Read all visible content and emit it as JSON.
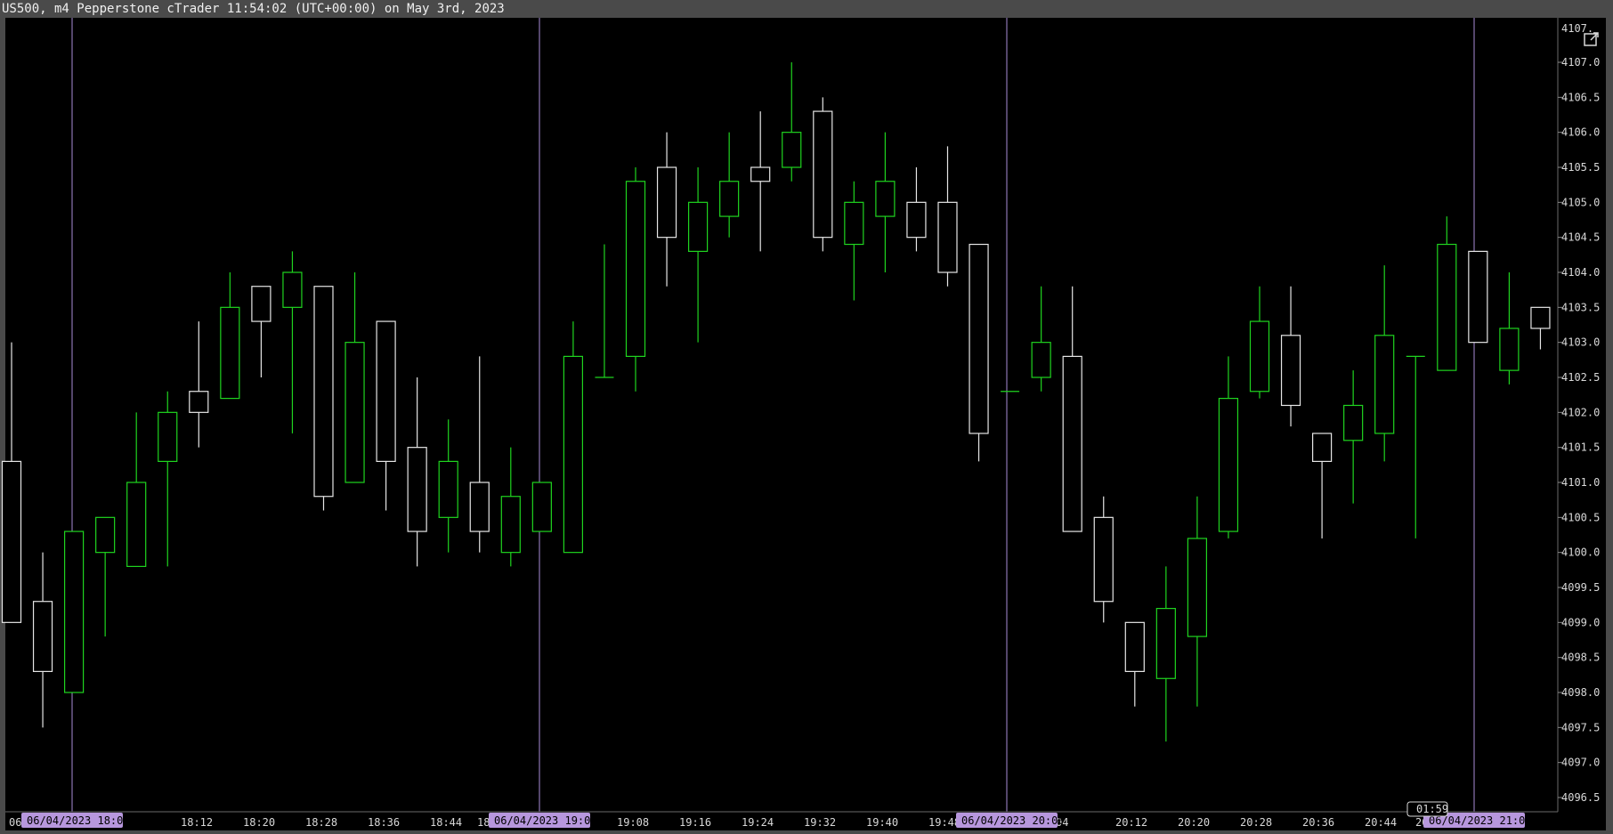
{
  "window": {
    "title": "US500, m4 Pepperstone cTrader 11:54:02 (UTC+00:00) on May 3rd, 2023"
  },
  "colors": {
    "background": "#000000",
    "bull": "#1fd41f",
    "bear": "#e6e6e6",
    "session_line": "#a98bd6",
    "session_label_bg": "#b797dd",
    "axis_text": "#d8d8d8"
  },
  "icons": {
    "popout": "external-link-icon"
  },
  "chart_data": {
    "type": "candlestick",
    "title": "",
    "xlabel": "",
    "ylabel": "",
    "ylim": [
      4096.5,
      4107.5
    ],
    "price_ticks": [
      "4107.0",
      "4106.5",
      "4106.0",
      "4105.5",
      "4105.0",
      "4104.5",
      "4104.0",
      "4103.5",
      "4103.0",
      "4102.5",
      "4102.0",
      "4101.5",
      "4101.0",
      "4100.5",
      "4100.0",
      "4099.5",
      "4099.0",
      "4098.5",
      "4098.0",
      "4097.5",
      "4097.0",
      "4096.5"
    ],
    "top_tick": "4107.",
    "time_ticks": [
      "06",
      "18:12",
      "18:20",
      "18:28",
      "18:36",
      "18:44",
      "18",
      "19:08",
      "19:16",
      "19:24",
      "19:32",
      "19:40",
      "19:48",
      "04",
      "20:12",
      "20:20",
      "20:28",
      "20:36",
      "20:44",
      "20"
    ],
    "session_labels": [
      "06/04/2023 18:00",
      "06/04/2023 19:00",
      "06/04/2023 20:00",
      "06/04/2023 21:00"
    ],
    "countdown": "01:59",
    "timeframe": "m4",
    "candles": [
      {
        "o": 4101.3,
        "h": 4103.0,
        "l": 4099.0,
        "c": 4099.0
      },
      {
        "o": 4099.3,
        "h": 4100.0,
        "l": 4097.5,
        "c": 4098.3
      },
      {
        "o": 4098.0,
        "h": 4100.3,
        "l": 4098.0,
        "c": 4100.3
      },
      {
        "o": 4100.0,
        "h": 4100.5,
        "l": 4098.8,
        "c": 4100.5
      },
      {
        "o": 4099.8,
        "h": 4102.0,
        "l": 4099.8,
        "c": 4101.0
      },
      {
        "o": 4101.3,
        "h": 4102.3,
        "l": 4099.8,
        "c": 4102.0
      },
      {
        "o": 4102.3,
        "h": 4103.3,
        "l": 4101.5,
        "c": 4102.0
      },
      {
        "o": 4102.2,
        "h": 4104.0,
        "l": 4102.2,
        "c": 4103.5
      },
      {
        "o": 4103.8,
        "h": 4103.8,
        "l": 4102.5,
        "c": 4103.3
      },
      {
        "o": 4103.5,
        "h": 4104.3,
        "l": 4101.7,
        "c": 4104.0
      },
      {
        "o": 4103.8,
        "h": 4103.8,
        "l": 4100.6,
        "c": 4100.8
      },
      {
        "o": 4101.0,
        "h": 4104.0,
        "l": 4101.0,
        "c": 4103.0
      },
      {
        "o": 4103.3,
        "h": 4103.3,
        "l": 4100.6,
        "c": 4101.3
      },
      {
        "o": 4101.5,
        "h": 4102.5,
        "l": 4099.8,
        "c": 4100.3
      },
      {
        "o": 4100.5,
        "h": 4101.9,
        "l": 4100.0,
        "c": 4101.3
      },
      {
        "o": 4101.0,
        "h": 4102.8,
        "l": 4100.0,
        "c": 4100.3
      },
      {
        "o": 4100.0,
        "h": 4101.5,
        "l": 4099.8,
        "c": 4100.8
      },
      {
        "o": 4100.3,
        "h": 4101.0,
        "l": 4100.3,
        "c": 4101.0
      },
      {
        "o": 4100.0,
        "h": 4103.3,
        "l": 4100.0,
        "c": 4102.8
      },
      {
        "o": 4102.5,
        "h": 4104.4,
        "l": 4102.5,
        "c": 4102.5
      },
      {
        "o": 4102.8,
        "h": 4105.5,
        "l": 4102.3,
        "c": 4105.3
      },
      {
        "o": 4105.5,
        "h": 4106.0,
        "l": 4103.8,
        "c": 4104.5
      },
      {
        "o": 4104.3,
        "h": 4105.5,
        "l": 4103.0,
        "c": 4105.0
      },
      {
        "o": 4104.8,
        "h": 4106.0,
        "l": 4104.5,
        "c": 4105.3
      },
      {
        "o": 4105.5,
        "h": 4106.3,
        "l": 4104.3,
        "c": 4105.3
      },
      {
        "o": 4105.5,
        "h": 4107.0,
        "l": 4105.3,
        "c": 4106.0
      },
      {
        "o": 4106.3,
        "h": 4106.5,
        "l": 4104.3,
        "c": 4104.5
      },
      {
        "o": 4104.4,
        "h": 4105.3,
        "l": 4103.6,
        "c": 4105.0
      },
      {
        "o": 4104.8,
        "h": 4106.0,
        "l": 4104.0,
        "c": 4105.3
      },
      {
        "o": 4105.0,
        "h": 4105.5,
        "l": 4104.3,
        "c": 4104.5
      },
      {
        "o": 4105.0,
        "h": 4105.8,
        "l": 4103.8,
        "c": 4104.0
      },
      {
        "o": 4104.4,
        "h": 4104.4,
        "l": 4101.3,
        "c": 4101.7
      },
      {
        "o": 4102.3,
        "h": 4102.3,
        "l": 4102.3,
        "c": 4102.3
      },
      {
        "o": 4102.5,
        "h": 4103.8,
        "l": 4102.3,
        "c": 4103.0
      },
      {
        "o": 4102.8,
        "h": 4103.8,
        "l": 4100.3,
        "c": 4100.3
      },
      {
        "o": 4100.5,
        "h": 4100.8,
        "l": 4099.0,
        "c": 4099.3
      },
      {
        "o": 4099.0,
        "h": 4099.0,
        "l": 4097.8,
        "c": 4098.3
      },
      {
        "o": 4098.2,
        "h": 4099.8,
        "l": 4097.3,
        "c": 4099.2
      },
      {
        "o": 4098.8,
        "h": 4100.8,
        "l": 4097.8,
        "c": 4100.2
      },
      {
        "o": 4100.3,
        "h": 4102.8,
        "l": 4100.2,
        "c": 4102.2
      },
      {
        "o": 4102.3,
        "h": 4103.8,
        "l": 4102.2,
        "c": 4103.3
      },
      {
        "o": 4103.1,
        "h": 4103.8,
        "l": 4101.8,
        "c": 4102.1
      },
      {
        "o": 4101.7,
        "h": 4101.7,
        "l": 4100.2,
        "c": 4101.3
      },
      {
        "o": 4101.6,
        "h": 4102.6,
        "l": 4100.7,
        "c": 4102.1
      },
      {
        "o": 4101.7,
        "h": 4104.1,
        "l": 4101.3,
        "c": 4103.1
      },
      {
        "o": 4102.8,
        "h": 4102.8,
        "l": 4100.2,
        "c": 4102.8
      },
      {
        "o": 4102.6,
        "h": 4104.8,
        "l": 4102.6,
        "c": 4104.4
      },
      {
        "o": 4104.3,
        "h": 4104.3,
        "l": 4103.0,
        "c": 4103.0
      },
      {
        "o": 4102.6,
        "h": 4104.0,
        "l": 4102.4,
        "c": 4103.2
      },
      {
        "o": 4103.5,
        "h": 4103.5,
        "l": 4102.9,
        "c": 4103.2
      }
    ]
  }
}
